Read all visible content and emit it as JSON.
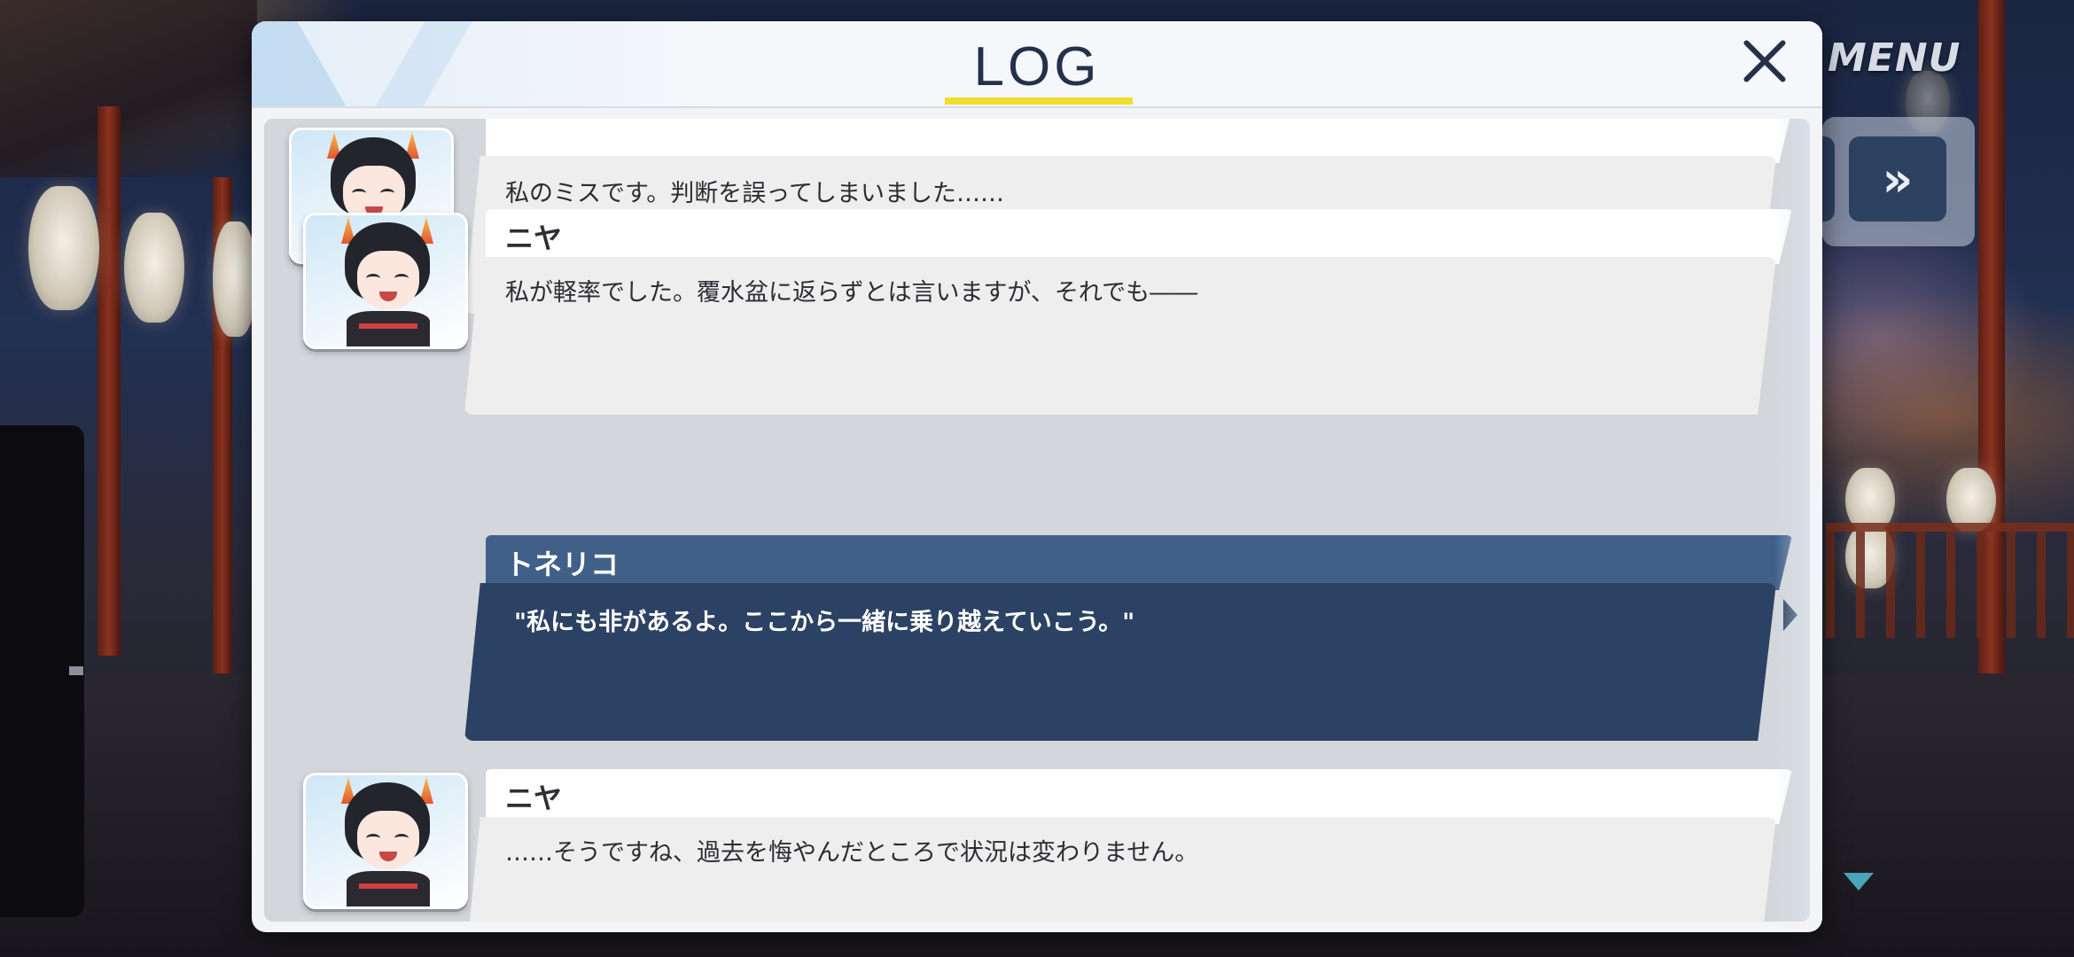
{
  "log": {
    "title": "LOG",
    "close_label": "×",
    "entries": [
      {
        "speaker": "",
        "is_player": false,
        "text": "私のミスです。判断を誤ってしまいました……\n百鬼夜行をこんな風にしてしまうなんて……"
      },
      {
        "speaker": "ニヤ",
        "is_player": false,
        "text": "私が軽率でした。覆水盆に返らずとは言いますが、それでも――"
      },
      {
        "speaker": "トネリコ",
        "is_player": true,
        "text": "\"私にも非があるよ。ここから一緒に乗り越えていこう。\""
      },
      {
        "speaker": "ニヤ",
        "is_player": false,
        "text": "……そうですね、過去を悔やんだところで状況は変わりません。"
      }
    ]
  },
  "game_ui": {
    "menu_label": "MENU",
    "fast_forward_label": "»"
  },
  "colors": {
    "title_underline": "#f1de2a",
    "player_name_bar": "#40608a",
    "player_dialog": "#2c4264",
    "npc_dialog": "#eeeeee"
  }
}
